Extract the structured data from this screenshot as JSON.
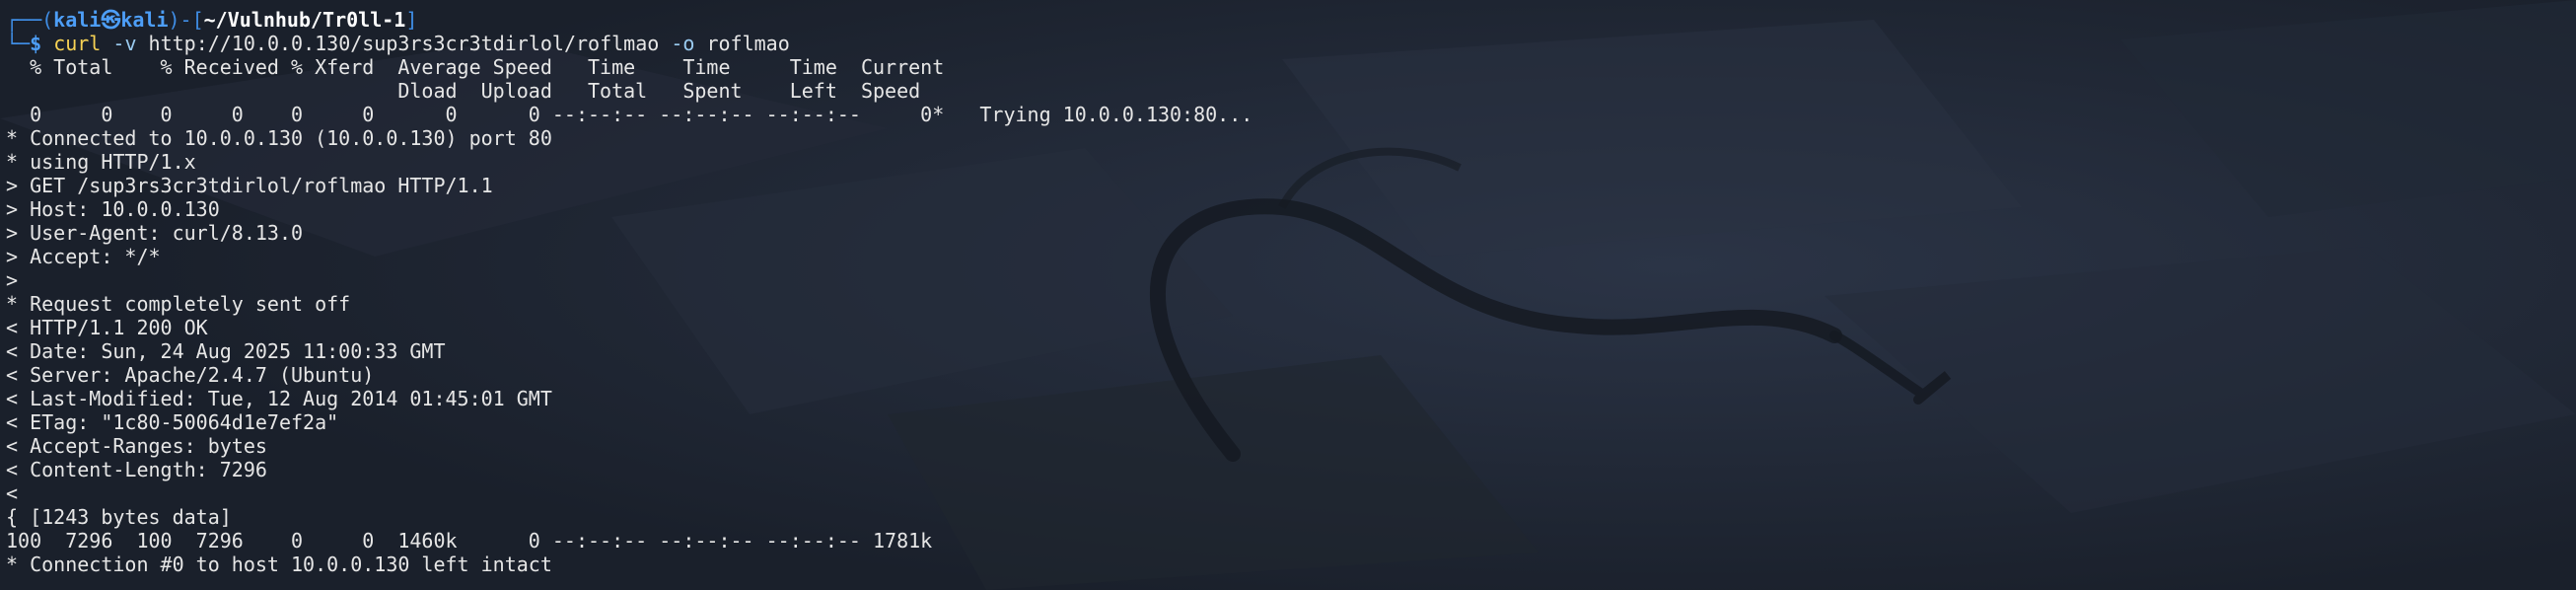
{
  "prompt": {
    "line1_prefix": "┌──(",
    "user": "kali",
    "at_symbol": "㉿",
    "host": "kali",
    "line1_mid": ")-[",
    "path": "~/Vulnhub/Tr0ll-1",
    "line1_suffix": "]",
    "line2_prefix": "└─",
    "dollar": "$ ",
    "command": "curl",
    "arg_flag_v": " -v ",
    "url": "http://10.0.0.130/sup3rs3cr3tdirlol/roflmao",
    "arg_flag_o": " -o ",
    "outfile": "roflmao"
  },
  "output_lines": [
    "  % Total    % Received % Xferd  Average Speed   Time    Time     Time  Current",
    "                                 Dload  Upload   Total   Spent    Left  Speed",
    "  0     0    0     0    0     0      0      0 --:--:-- --:--:-- --:--:--     0*   Trying 10.0.0.130:80...",
    "* Connected to 10.0.0.130 (10.0.0.130) port 80",
    "* using HTTP/1.x",
    "> GET /sup3rs3cr3tdirlol/roflmao HTTP/1.1",
    "> Host: 10.0.0.130",
    "> User-Agent: curl/8.13.0",
    "> Accept: */*",
    ">",
    "* Request completely sent off",
    "< HTTP/1.1 200 OK",
    "< Date: Sun, 24 Aug 2025 11:00:33 GMT",
    "< Server: Apache/2.4.7 (Ubuntu)",
    "< Last-Modified: Tue, 12 Aug 2014 01:45:01 GMT",
    "< ETag: \"1c80-50064d1e7ef2a\"",
    "< Accept-Ranges: bytes",
    "< Content-Length: 7296",
    "<",
    "{ [1243 bytes data]",
    "100  7296  100  7296    0     0  1460k      0 --:--:-- --:--:-- --:--:-- 1781k",
    "* Connection #0 to host 10.0.0.130 left intact"
  ],
  "colors": {
    "background": "#1d2330",
    "prompt_blue": "#3f8de5",
    "command_yellow": "#f7d254",
    "text": "#e6e6e6"
  }
}
